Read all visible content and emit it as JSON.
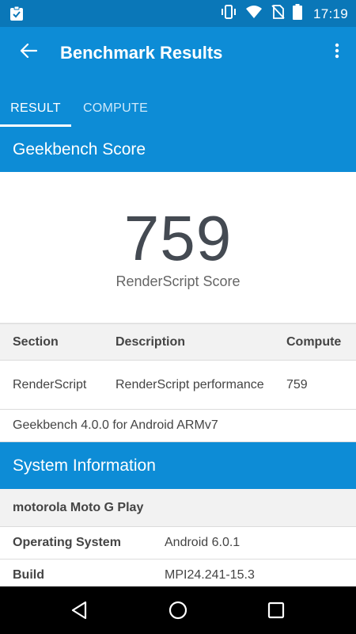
{
  "status_bar": {
    "time": "17:19",
    "icons": [
      "clipboard-check-icon",
      "vibrate-icon",
      "wifi-icon",
      "no-sim-icon",
      "battery-icon"
    ]
  },
  "app_bar": {
    "title": "Benchmark Results",
    "tabs": [
      {
        "label": "RESULT",
        "active": true
      },
      {
        "label": "COMPUTE",
        "active": false
      }
    ]
  },
  "geekbench": {
    "header": "Geekbench Score",
    "score": "759",
    "score_label": "RenderScript Score",
    "table": {
      "headers": [
        "Section",
        "Description",
        "Compute"
      ],
      "rows": [
        {
          "section": "RenderScript",
          "description": "RenderScript performance",
          "compute": "759"
        }
      ]
    },
    "version": "Geekbench 4.0.0 for Android ARMv7"
  },
  "system_info": {
    "header": "System Information",
    "device": "motorola Moto G Play",
    "fields": [
      {
        "key": "Operating System",
        "value": "Android 6.0.1"
      },
      {
        "key": "Build",
        "value": "MPI24.241-15.3"
      }
    ]
  },
  "colors": {
    "status_bar": "#0a77b8",
    "primary": "#0d8cd6",
    "score_text": "#444a52"
  }
}
